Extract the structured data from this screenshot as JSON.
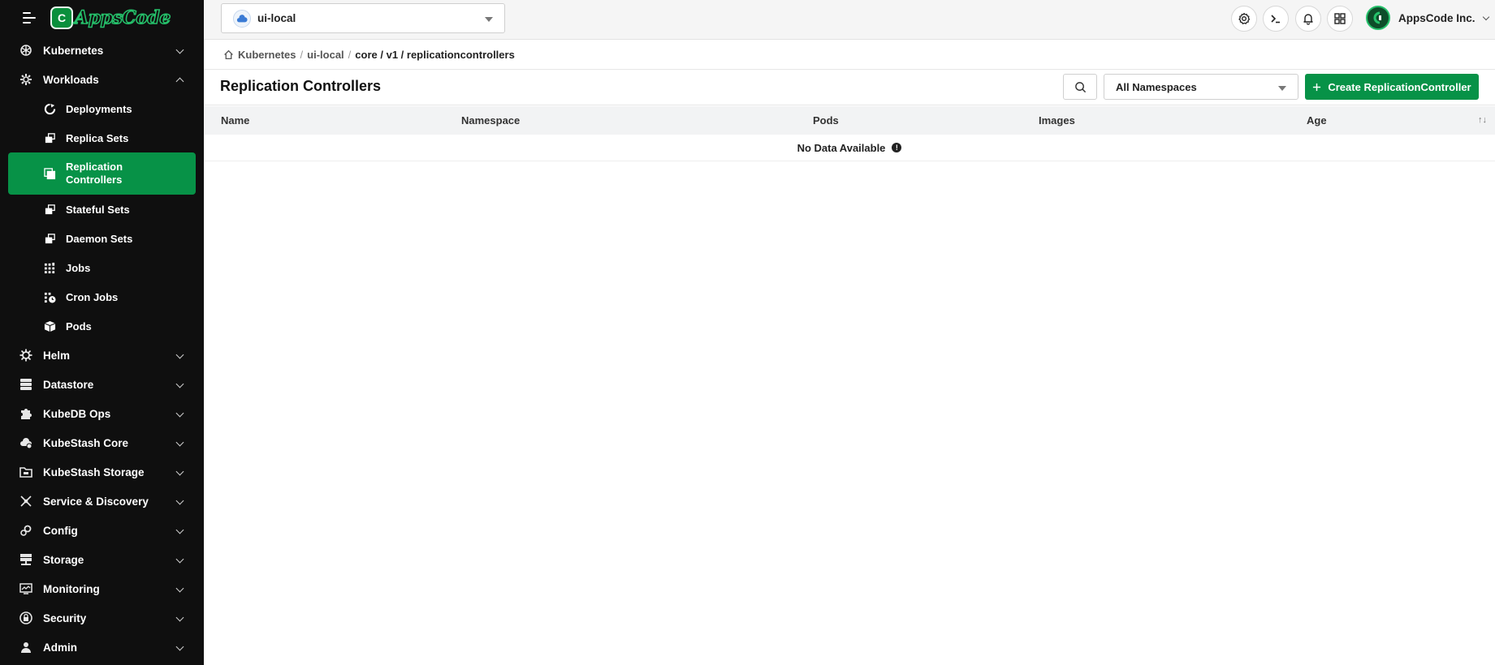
{
  "brand": {
    "logo_text": "AppsCode",
    "logo_mark": "C"
  },
  "sidebar": {
    "groups": [
      {
        "label": "Kubernetes",
        "icon": "kubernetes-icon",
        "expanded": false
      },
      {
        "label": "Workloads",
        "icon": "workloads-icon",
        "expanded": true,
        "items": [
          {
            "label": "Deployments",
            "icon": "deployment-icon"
          },
          {
            "label": "Replica Sets",
            "icon": "replicaset-icon"
          },
          {
            "label": "Replication Controllers",
            "icon": "replication-controller-icon",
            "active": true
          },
          {
            "label": "Stateful Sets",
            "icon": "statefulset-icon"
          },
          {
            "label": "Daemon Sets",
            "icon": "daemonset-icon"
          },
          {
            "label": "Jobs",
            "icon": "jobs-icon"
          },
          {
            "label": "Cron Jobs",
            "icon": "cronjobs-icon"
          },
          {
            "label": "Pods",
            "icon": "pods-icon"
          }
        ]
      },
      {
        "label": "Helm",
        "icon": "helm-icon"
      },
      {
        "label": "Datastore",
        "icon": "datastore-icon"
      },
      {
        "label": "KubeDB Ops",
        "icon": "puzzle-icon"
      },
      {
        "label": "KubeStash Core",
        "icon": "kubestash-core-icon"
      },
      {
        "label": "KubeStash Storage",
        "icon": "folder-icon"
      },
      {
        "label": "Service & Discovery",
        "icon": "service-discovery-icon"
      },
      {
        "label": "Config",
        "icon": "config-icon"
      },
      {
        "label": "Storage",
        "icon": "storage-icon"
      },
      {
        "label": "Monitoring",
        "icon": "monitoring-icon"
      },
      {
        "label": "Security",
        "icon": "lock-icon"
      },
      {
        "label": "Admin",
        "icon": "admin-icon"
      }
    ]
  },
  "topbar": {
    "cluster": "ui-local",
    "org": "AppsCode Inc.",
    "actions": [
      "settings-icon",
      "terminal-icon",
      "bell-icon",
      "apps-grid-icon"
    ]
  },
  "breadcrumb": {
    "items": [
      "Kubernetes",
      "ui-local",
      "core / v1 / replicationcontrollers"
    ]
  },
  "page": {
    "title": "Replication Controllers",
    "namespace_select": "All Namespaces",
    "create_button": "Create ReplicationController"
  },
  "table": {
    "columns": [
      "Name",
      "Namespace",
      "Pods",
      "Images",
      "Age"
    ],
    "sort_indicator": "↑↓",
    "empty_message": "No Data Available",
    "info_glyph": "!"
  },
  "colors": {
    "accent": "#079247",
    "sidebar_bg": "#0f0f0f"
  }
}
